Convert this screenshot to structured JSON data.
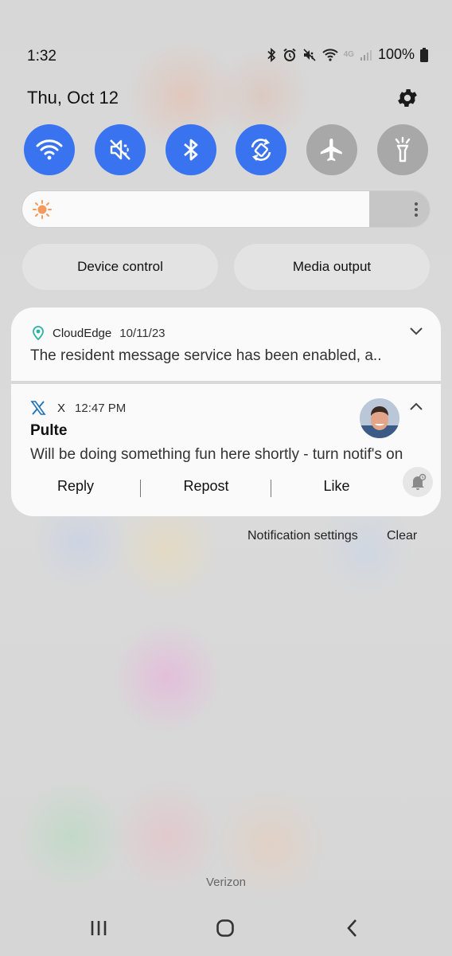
{
  "status_bar": {
    "time": "1:32",
    "battery": "100%",
    "network": "4G",
    "icons": [
      "bluetooth-icon",
      "alarm-icon",
      "mute-icon",
      "wifi-icon",
      "signal-icon",
      "battery-icon"
    ]
  },
  "header": {
    "date": "Thu, Oct 12",
    "settings_icon": "gear-icon"
  },
  "quick_settings": [
    {
      "icon": "wifi-icon",
      "state": "on"
    },
    {
      "icon": "mute-icon",
      "state": "on"
    },
    {
      "icon": "bluetooth-icon",
      "state": "on"
    },
    {
      "icon": "auto-rotate-icon",
      "state": "on"
    },
    {
      "icon": "airplane-icon",
      "state": "off"
    },
    {
      "icon": "flashlight-icon",
      "state": "off"
    }
  ],
  "brightness": {
    "level": 0.85,
    "icon": "sun-icon"
  },
  "controls": {
    "device_control": "Device control",
    "media_output": "Media output"
  },
  "notifications": [
    {
      "app": "CloudEdge",
      "time": "10/11/23",
      "text": "The resident message service has been enabled, a..",
      "expanded": false
    },
    {
      "app": "X",
      "time": "12:47 PM",
      "title": "Pulte",
      "text": "Will be doing something fun here shortly - turn notif's on",
      "actions": [
        "Reply",
        "Repost",
        "Like"
      ],
      "expanded": true
    }
  ],
  "footer_links": {
    "notification_settings": "Notification settings",
    "clear": "Clear"
  },
  "carrier": "Verizon",
  "colors": {
    "accent": "#3a73f0",
    "toggle_off": "#a8a8a8",
    "card_bg": "#fafafa"
  }
}
